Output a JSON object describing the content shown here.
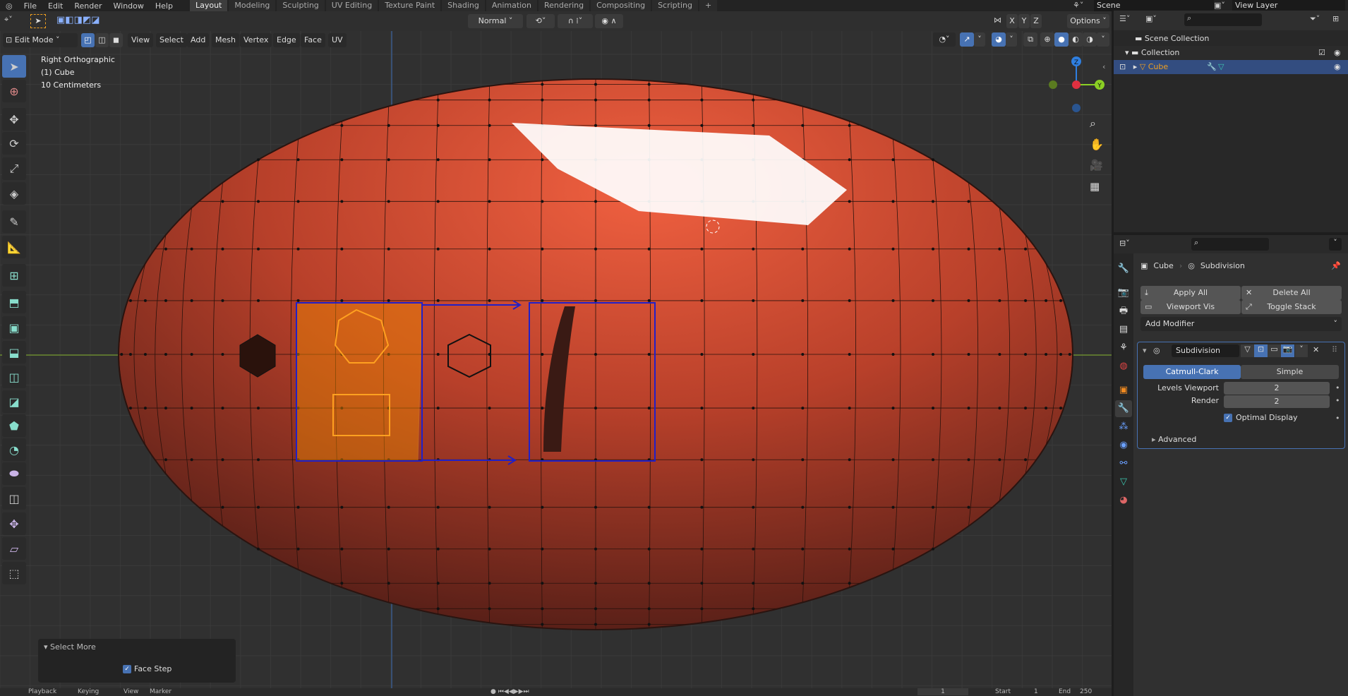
{
  "topbar": {
    "menus": [
      "File",
      "Edit",
      "Render",
      "Window",
      "Help"
    ],
    "workspaces": [
      "Layout",
      "Modeling",
      "Sculpting",
      "UV Editing",
      "Texture Paint",
      "Shading",
      "Animation",
      "Rendering",
      "Compositing",
      "Scripting"
    ],
    "active_workspace": "Layout",
    "add_tab": "+",
    "scene": "Scene",
    "view_layer": "View Layer"
  },
  "header": {
    "transform_orientation": "Normal",
    "axes": [
      "X",
      "Y",
      "Z"
    ],
    "options": "Options"
  },
  "viewport_header": {
    "mode": "Edit Mode",
    "menus": [
      "View",
      "Select",
      "Add",
      "Mesh",
      "Vertex",
      "Edge",
      "Face",
      "UV"
    ]
  },
  "viewport_info": {
    "view": "Right Orthographic",
    "object": "(1) Cube",
    "scale": "10 Centimeters"
  },
  "gizmo": {
    "axes": [
      "Z",
      "Y"
    ]
  },
  "last_operator": {
    "title": "Select More",
    "face_step_label": "Face Step",
    "face_step": true
  },
  "outliner": {
    "items": [
      {
        "label": "Scene Collection"
      },
      {
        "label": "Collection"
      },
      {
        "label": "Cube"
      }
    ]
  },
  "properties": {
    "breadcrumb_object": "Cube",
    "breadcrumb_modifier": "Subdivision",
    "apply_all": "Apply All",
    "delete_all": "Delete All",
    "viewport_vis": "Viewport Vis",
    "toggle_stack": "Toggle Stack",
    "add_modifier": "Add Modifier",
    "modifier": {
      "name": "Subdivision",
      "type_options": [
        "Catmull-Clark",
        "Simple"
      ],
      "selected_type": "Catmull-Clark",
      "levels_viewport_label": "Levels Viewport",
      "levels_viewport": "2",
      "render_label": "Render",
      "render": "2",
      "optimal_display_label": "Optimal Display",
      "optimal_display": true,
      "advanced": "Advanced"
    }
  },
  "timeline": {
    "menus": [
      "Playback",
      "Keying",
      "View",
      "Marker"
    ],
    "frame": "1",
    "start_label": "Start",
    "start": "1",
    "end_label": "End",
    "end": "250"
  },
  "colors": {
    "accent": "#4772b3",
    "mesh": "#c0442a",
    "selection": "#f08a00",
    "annotation": "#2020c8"
  }
}
